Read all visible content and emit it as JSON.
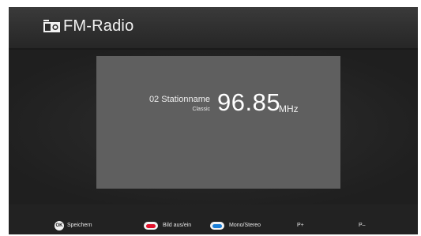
{
  "header": {
    "title": "FM-Radio",
    "icon": "radio-icon"
  },
  "station": {
    "name": "02 Stationname",
    "genre": "Classic",
    "frequency": "96.85",
    "unit": "MHz"
  },
  "footer": {
    "ok_key_label": "OK",
    "save_label": "Speichern",
    "picture_label": "Bild aus/ein",
    "mono_stereo_label": "Mono/Stereo",
    "p_plus_label": "P+",
    "p_minus_label": "P–"
  },
  "colors": {
    "background": "#222222",
    "panel": "#5f5f5f",
    "red_key": "#e0112b",
    "blue_key": "#1b7fd8"
  }
}
